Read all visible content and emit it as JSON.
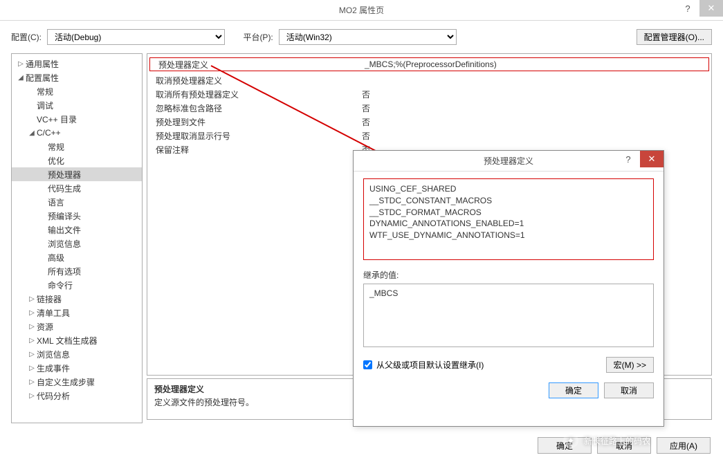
{
  "window": {
    "title": "MO2 属性页"
  },
  "config_row": {
    "config_label": "配置(C):",
    "config_value": "活动(Debug)",
    "platform_label": "平台(P):",
    "platform_value": "活动(Win32)",
    "manager_btn": "配置管理器(O)..."
  },
  "tree": {
    "items": [
      {
        "label": "通用属性",
        "depth": 1,
        "arrow": "▷"
      },
      {
        "label": "配置属性",
        "depth": 1,
        "arrow": "◢"
      },
      {
        "label": "常规",
        "depth": 2,
        "arrow": ""
      },
      {
        "label": "调试",
        "depth": 2,
        "arrow": ""
      },
      {
        "label": "VC++ 目录",
        "depth": 2,
        "arrow": ""
      },
      {
        "label": "C/C++",
        "depth": 2,
        "arrow": "◢"
      },
      {
        "label": "常规",
        "depth": 3,
        "arrow": ""
      },
      {
        "label": "优化",
        "depth": 3,
        "arrow": ""
      },
      {
        "label": "预处理器",
        "depth": 3,
        "arrow": "",
        "selected": true
      },
      {
        "label": "代码生成",
        "depth": 3,
        "arrow": ""
      },
      {
        "label": "语言",
        "depth": 3,
        "arrow": ""
      },
      {
        "label": "预编译头",
        "depth": 3,
        "arrow": ""
      },
      {
        "label": "输出文件",
        "depth": 3,
        "arrow": ""
      },
      {
        "label": "浏览信息",
        "depth": 3,
        "arrow": ""
      },
      {
        "label": "高级",
        "depth": 3,
        "arrow": ""
      },
      {
        "label": "所有选项",
        "depth": 3,
        "arrow": ""
      },
      {
        "label": "命令行",
        "depth": 3,
        "arrow": ""
      },
      {
        "label": "链接器",
        "depth": 2,
        "arrow": "▷"
      },
      {
        "label": "清单工具",
        "depth": 2,
        "arrow": "▷"
      },
      {
        "label": "资源",
        "depth": 2,
        "arrow": "▷"
      },
      {
        "label": "XML 文档生成器",
        "depth": 2,
        "arrow": "▷"
      },
      {
        "label": "浏览信息",
        "depth": 2,
        "arrow": "▷"
      },
      {
        "label": "生成事件",
        "depth": 2,
        "arrow": "▷"
      },
      {
        "label": "自定义生成步骤",
        "depth": 2,
        "arrow": "▷"
      },
      {
        "label": "代码分析",
        "depth": 2,
        "arrow": "▷"
      }
    ]
  },
  "grid": {
    "rows": [
      {
        "k": "预处理器定义",
        "v": "_MBCS;%(PreprocessorDefinitions)",
        "highlight": true
      },
      {
        "k": "取消预处理器定义",
        "v": ""
      },
      {
        "k": "取消所有预处理器定义",
        "v": "否"
      },
      {
        "k": "忽略标准包含路径",
        "v": "否"
      },
      {
        "k": "预处理到文件",
        "v": "否"
      },
      {
        "k": "预处理取消显示行号",
        "v": "否"
      },
      {
        "k": "保留注释",
        "v": "否"
      }
    ]
  },
  "desc": {
    "title": "预处理器定义",
    "body": "定义源文件的预处理符号。"
  },
  "buttons": {
    "ok": "确定",
    "cancel": "取消",
    "apply": "应用(A)"
  },
  "popup": {
    "title": "预处理器定义",
    "definitions": "USING_CEF_SHARED\n__STDC_CONSTANT_MACROS\n__STDC_FORMAT_MACROS\nDYNAMIC_ANNOTATIONS_ENABLED=1\nWTF_USE_DYNAMIC_ANNOTATIONS=1",
    "inherited_label": "继承的值:",
    "inherited_value": "_MBCS",
    "inherit_checkbox": "从父级或项目默认设置继承(I)",
    "macro_btn": "宏(M) >>",
    "ok": "确定",
    "cancel": "取消"
  },
  "watermark": "新长征路上的码农"
}
